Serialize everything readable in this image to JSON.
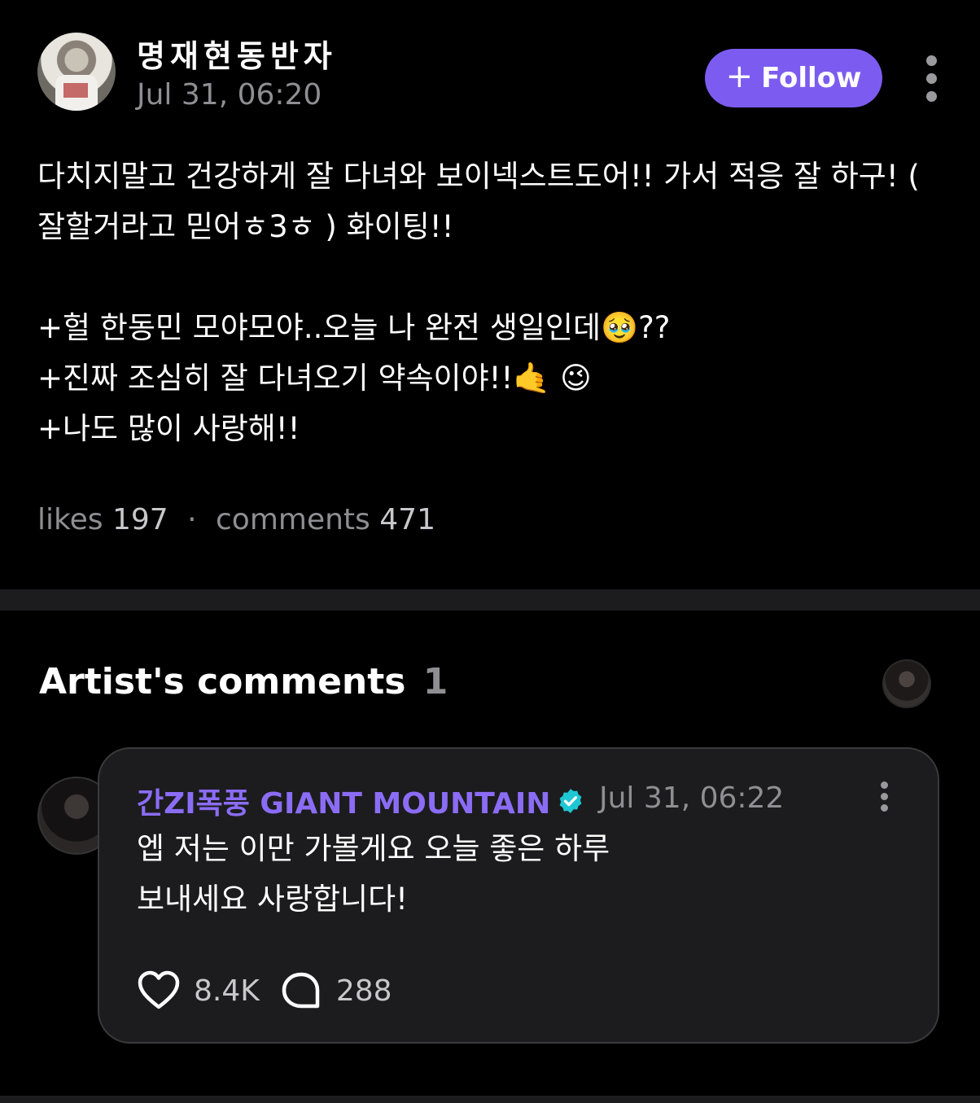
{
  "post": {
    "author": "명재현동반자",
    "timestamp": "Jul 31, 06:20",
    "follow_label": "Follow",
    "body": "다치지말고 건강하게 잘 다녀와 보이넥스트도어!! 가서 적응 잘 하구! ( 잘할거라고 믿어ㅎ3ㅎ ) 화이팅!!\n\n+헐 한동민 모야모야..오늘 나 완전 생일인데🥹??\n+진짜 조심히 잘 다녀오기 약속이야!!🤙 😉\n+나도 많이 사랑해!!",
    "likes_label": "likes",
    "likes_count": "197",
    "separator": "·",
    "comments_label": "comments",
    "comments_count": "471"
  },
  "artist_section": {
    "title": "Artist's comments",
    "count": "1"
  },
  "comment": {
    "author": "간ZI폭풍 GIANT MOUNTAIN",
    "verified_icon": "verified-check-icon",
    "timestamp": "Jul 31, 06:22",
    "text": "엡 저는 이만 가볼게요 오늘 좋은 하루\n보내세요 사랑합니다!",
    "likes": "8.4K",
    "replies": "288"
  },
  "colors": {
    "accent": "#7c5cf0",
    "author": "#8b6cf5",
    "verified": "#1fc7d4",
    "muted": "#8e8e93",
    "background": "#000000"
  }
}
